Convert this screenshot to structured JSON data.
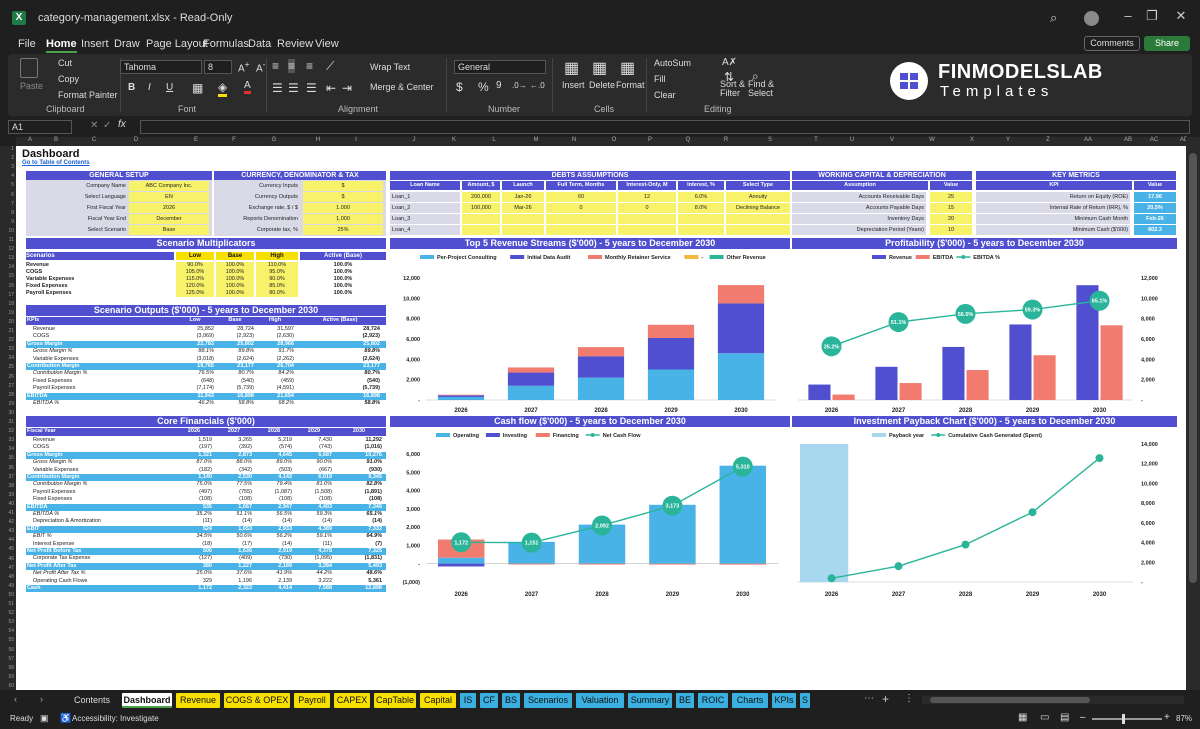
{
  "titlebar": {
    "title": "category-management.xlsx  -  Read-Only"
  },
  "menu": [
    "File",
    "Home",
    "Insert",
    "Draw",
    "Page Layout",
    "Formulas",
    "Data",
    "Review",
    "View"
  ],
  "menu_right": {
    "comments": "Comments",
    "share": "Share"
  },
  "ribbon": {
    "paste": "Paste",
    "cut": "Cut",
    "copy": "Copy",
    "format_painter": "Format Painter",
    "font_name": "Tahoma",
    "font_size": "8",
    "wrap_text": "Wrap Text",
    "merge_center": "Merge & Center",
    "number_format": "General",
    "insert": "Insert",
    "delete": "Delete",
    "format": "Format",
    "autosum": "AutoSum",
    "fill": "Fill",
    "clear": "Clear",
    "sort_filter": "Sort & Filter",
    "find_select": "Find & Select",
    "groups": [
      "Clipboard",
      "Font",
      "Alignment",
      "Number",
      "Cells",
      "Editing"
    ]
  },
  "brand": {
    "name": "FINMODELSLAB",
    "tagline": "Templates"
  },
  "formula": {
    "cell": "A1"
  },
  "columns": [
    "A",
    "B",
    "C",
    "D",
    "E",
    "F",
    "G",
    "H",
    "I",
    "J",
    "K",
    "L",
    "M",
    "N",
    "O",
    "P",
    "Q",
    "R",
    "S",
    "T",
    "U",
    "V",
    "W",
    "X",
    "Y",
    "Z",
    "AA",
    "AB",
    "AC",
    "AD"
  ],
  "sheet": {
    "title": "Dashboard",
    "toc_link": "Go to Table of Contents"
  },
  "general_setup": {
    "title": "GENERAL SETUP",
    "rows": [
      {
        "label": "Company Name",
        "value": "ABC Company Inc."
      },
      {
        "label": "Select Language",
        "value": "EN"
      },
      {
        "label": "First Fiscal Year",
        "value": "2026"
      },
      {
        "label": "Fiscal Year End",
        "value": "December"
      },
      {
        "label": "Select Scenario",
        "value": "Base"
      }
    ]
  },
  "currency": {
    "title": "CURRENCY, DENOMINATOR & TAX",
    "rows": [
      {
        "label": "Currency Inputs",
        "value": "$"
      },
      {
        "label": "Currency Outputs",
        "value": "$"
      },
      {
        "label": "Exchange rate, $ / $",
        "value": "1.000"
      },
      {
        "label": "Reports Denomination",
        "value": "1,000"
      },
      {
        "label": "Corporate tax, %",
        "value": "25%"
      }
    ]
  },
  "debts": {
    "title": "DEBTS ASSUMPTIONS",
    "headers": [
      "Loan Name",
      "Amount, $",
      "Launch",
      "Full Term, Months",
      "Interest-Only, M",
      "Interest, %",
      "Select Type"
    ],
    "rows": [
      [
        "Loan_1",
        "200,000",
        "Jan-26",
        "60",
        "12",
        "6.0%",
        "Annuity"
      ],
      [
        "Loan_2",
        "100,000",
        "Mar-26",
        "0",
        "0",
        "8.0%",
        "Declining Balance"
      ],
      [
        "Loan_3",
        "",
        "",
        "",
        "",
        "",
        ""
      ],
      [
        "Loan_4",
        "",
        "",
        "",
        "",
        "",
        ""
      ]
    ]
  },
  "working_capital": {
    "title": "WORKING CAPITAL & DEPRECIATION",
    "headers": [
      "Assumption",
      "Value"
    ],
    "rows": [
      [
        "Accounts Receivable Days",
        "25"
      ],
      [
        "Accounts Payable Days",
        "15"
      ],
      [
        "Inventory Days",
        "20"
      ],
      [
        "Depreciation Period (Years)",
        "10"
      ]
    ]
  },
  "key_metrics": {
    "title": "KEY METRICS",
    "headers": [
      "KPI",
      "Value"
    ],
    "rows": [
      [
        "Return on Equity (ROE)",
        "17.96"
      ],
      [
        "Internal Rate of Return (IRR), %",
        "20.5%"
      ],
      [
        "Minimum Cash Month",
        "Feb-26"
      ],
      [
        "Minimum Cash ($'000)",
        "802.3"
      ]
    ]
  },
  "multiplicators": {
    "title": "Scenario Multiplicators",
    "headers": [
      "Scenarios",
      "Low",
      "Base",
      "High",
      "Active (Base)"
    ],
    "rows": [
      [
        "Revenue",
        "90.0%",
        "100.0%",
        "110.0%",
        "100.0%"
      ],
      [
        "COGS",
        "105.0%",
        "100.0%",
        "95.0%",
        "100.0%"
      ],
      [
        "Variable Expenses",
        "115.0%",
        "100.0%",
        "90.0%",
        "100.0%"
      ],
      [
        "Fixed Expenses",
        "120.0%",
        "100.0%",
        "85.0%",
        "100.0%"
      ],
      [
        "Payroll Expenses",
        "125.0%",
        "100.0%",
        "80.0%",
        "100.0%"
      ]
    ]
  },
  "scenario_outputs": {
    "title": "Scenario Outputs ($'000) - 5 years to December 2030",
    "headers": [
      "KPIs",
      "Low",
      "Base",
      "High",
      "Active (Base)"
    ],
    "rows": [
      {
        "cells": [
          "Revenue",
          "25,852",
          "28,724",
          "31,597",
          "28,724"
        ],
        "style": ""
      },
      {
        "cells": [
          "COGS",
          "(3,069)",
          "(2,923)",
          "(2,630)",
          "(2,923)"
        ],
        "style": ""
      },
      {
        "cells": [
          "Gross Margin",
          "22,783",
          "25,802",
          "28,966",
          "25,802"
        ],
        "style": "hl"
      },
      {
        "cells": [
          "Gross Margin %",
          "88.1%",
          "89.8%",
          "91.7%",
          "89.8%"
        ],
        "style": "it"
      },
      {
        "cells": [
          "Variable Expenses",
          "(3,018)",
          "(2,624)",
          "(2,262)",
          "(2,624)"
        ],
        "style": ""
      },
      {
        "cells": [
          "Contribution Margin",
          "19,765",
          "23,177",
          "26,704",
          "23,177"
        ],
        "style": "hl"
      },
      {
        "cells": [
          "Contribution Margin %",
          "76.5%",
          "80.7%",
          "84.2%",
          "80.7%"
        ],
        "style": "it"
      },
      {
        "cells": [
          "Fixed Expenses",
          "(648)",
          "(540)",
          "(459)",
          "(540)"
        ],
        "style": ""
      },
      {
        "cells": [
          "Payroll Expenses",
          "(7,174)",
          "(5,739)",
          "(4,591)",
          "(5,739)"
        ],
        "style": ""
      },
      {
        "cells": [
          "EBITDA",
          "11,943",
          "16,898",
          "21,654",
          "16,898"
        ],
        "style": "hl"
      },
      {
        "cells": [
          "EBITDA %",
          "46.2%",
          "58.8%",
          "68.2%",
          "58.8%"
        ],
        "style": "it"
      }
    ]
  },
  "core_financials": {
    "title": "Core Financials ($'000)",
    "headers": [
      "Fiscal Year",
      "2026",
      "2027",
      "2028",
      "2029",
      "2030"
    ],
    "rows": [
      {
        "cells": [
          "Revenue",
          "1,519",
          "3,265",
          "5,219",
          "7,430",
          "11,292"
        ],
        "style": ""
      },
      {
        "cells": [
          "COGS",
          "(197)",
          "(392)",
          "(574)",
          "(743)",
          "(1,016)"
        ],
        "style": ""
      },
      {
        "cells": [
          "Gross Margin",
          "1,321",
          "2,873",
          "4,645",
          "6,687",
          "10,276"
        ],
        "style": "hl"
      },
      {
        "cells": [
          "Gross Margin %",
          "87.0%",
          "88.0%",
          "89.0%",
          "90.0%",
          "91.0%"
        ],
        "style": "it"
      },
      {
        "cells": [
          "Variable Expenses",
          "(182)",
          "(342)",
          "(503)",
          "(667)",
          "(930)"
        ],
        "style": ""
      },
      {
        "cells": [
          "Contribution Margin",
          "1,140",
          "2,530",
          "4,142",
          "6,019",
          "9,345"
        ],
        "style": "hl"
      },
      {
        "cells": [
          "Contribution Margin %",
          "75.0%",
          "77.5%",
          "79.4%",
          "81.0%",
          "82.8%"
        ],
        "style": "it"
      },
      {
        "cells": [
          "Payroll Expenses",
          "(497)",
          "(755)",
          "(1,087)",
          "(1,508)",
          "(1,891)"
        ],
        "style": ""
      },
      {
        "cells": [
          "Fixed Expenses",
          "(108)",
          "(108)",
          "(108)",
          "(108)",
          "(108)"
        ],
        "style": ""
      },
      {
        "cells": [
          "EBITDA",
          "535",
          "1,667",
          "2,947",
          "4,403",
          "7,346"
        ],
        "style": "hl"
      },
      {
        "cells": [
          "EBITDA %",
          "35.2%",
          "51.1%",
          "56.5%",
          "59.3%",
          "65.1%"
        ],
        "style": "it"
      },
      {
        "cells": [
          "Depreciation & Amortization",
          "(11)",
          "(14)",
          "(14)",
          "(14)",
          "(14)"
        ],
        "style": ""
      },
      {
        "cells": [
          "EBIT",
          "524",
          "1,653",
          "2,933",
          "4,389",
          "7,332"
        ],
        "style": "hl"
      },
      {
        "cells": [
          "EBIT %",
          "34.5%",
          "50.6%",
          "56.2%",
          "59.1%",
          "64.9%"
        ],
        "style": "it"
      },
      {
        "cells": [
          "Interest Expense",
          "(18)",
          "(17)",
          "(14)",
          "(11)",
          "(7)"
        ],
        "style": ""
      },
      {
        "cells": [
          "Net Profit Before Tax",
          "506",
          "1,636",
          "2,919",
          "4,378",
          "7,325"
        ],
        "style": "hl"
      },
      {
        "cells": [
          "Corporate Tax Expense",
          "(127)",
          "(409)",
          "(730)",
          "(1,095)",
          "(1,831)"
        ],
        "style": ""
      },
      {
        "cells": [
          "Net Profit After Tax",
          "380",
          "1,227",
          "2,189",
          "3,284",
          "5,493"
        ],
        "style": "hl"
      },
      {
        "cells": [
          "Net Profit After Tax %",
          "25.0%",
          "37.6%",
          "41.9%",
          "44.2%",
          "48.6%"
        ],
        "style": "it"
      },
      {
        "cells": [
          "Operating Cash Flows",
          "329",
          "1,196",
          "2,139",
          "3,222",
          "5,361"
        ],
        "style": ""
      },
      {
        "cells": [
          "Cash",
          "1,172",
          "2,323",
          "4,414",
          "7,588",
          "12,898"
        ],
        "style": "hl"
      }
    ]
  },
  "chart_data": [
    {
      "type": "bar",
      "title": "Top 5 Revenue Streams ($'000) - 5 years to December 2030",
      "categories": [
        "2026",
        "2027",
        "2028",
        "2029",
        "2030"
      ],
      "ylim": [
        0,
        12000
      ],
      "yticks": [
        "-",
        "2,000",
        "4,000",
        "6,000",
        "8,000",
        "10,000",
        "12,000"
      ],
      "series": [
        {
          "name": "Per-Project Consulting",
          "color": "#49b3e8",
          "values": [
            300,
            1400,
            2200,
            3000,
            4600
          ]
        },
        {
          "name": "Initial Data Audit",
          "color": "#4f4fd0",
          "values": [
            160,
            1300,
            2100,
            3100,
            4900
          ]
        },
        {
          "name": "Monthly Retainer Service",
          "color": "#f07b6e",
          "values": [
            60,
            500,
            900,
            1300,
            1800
          ]
        },
        {
          "name": "-",
          "color": "#f6b73c",
          "values": [
            0,
            0,
            0,
            0,
            0
          ]
        },
        {
          "name": "Other Revenue",
          "color": "#2ab59a",
          "values": [
            0,
            0,
            0,
            0,
            0
          ]
        }
      ]
    },
    {
      "type": "bar",
      "title": "Profitability ($'000) - 5 years to December 2030",
      "categories": [
        "2026",
        "2027",
        "2028",
        "2029",
        "2030"
      ],
      "ylim": [
        0,
        12000
      ],
      "yticks": [
        "-",
        "2,000",
        "4,000",
        "6,000",
        "8,000",
        "10,000",
        "12,000"
      ],
      "series": [
        {
          "name": "Revenue",
          "color": "#4f4fd0",
          "values": [
            1519,
            3265,
            5219,
            7430,
            11292
          ]
        },
        {
          "name": "EBITDA",
          "color": "#f07b6e",
          "values": [
            535,
            1667,
            2947,
            4403,
            7346
          ]
        }
      ],
      "line": {
        "name": "EBITDA %",
        "color": "#2ab59a",
        "values": [
          35.2,
          51.1,
          56.5,
          59.3,
          65.1
        ],
        "labels": [
          "35.2%",
          "51.1%",
          "56.5%",
          "59.3%",
          "65.1%"
        ],
        "ylim": [
          0,
          80
        ]
      }
    },
    {
      "type": "bar",
      "title": "Cash flow ($'000) - 5 years to December 2030",
      "categories": [
        "2026",
        "2027",
        "2028",
        "2029",
        "2030"
      ],
      "ylim": [
        -1000,
        6000
      ],
      "yticks": [
        "(1,000)",
        "-",
        "1,000",
        "2,000",
        "3,000",
        "4,000",
        "5,000",
        "6,000"
      ],
      "series": [
        {
          "name": "Operating",
          "color": "#49b3e8",
          "values": [
            329,
            1196,
            2139,
            3222,
            5361
          ]
        },
        {
          "name": "Investing",
          "color": "#4f4fd0",
          "values": [
            -150,
            0,
            0,
            0,
            0
          ]
        },
        {
          "name": "Financing",
          "color": "#f07b6e",
          "values": [
            993,
            -45,
            -48,
            -48,
            -51
          ]
        }
      ],
      "line": {
        "name": "Net Cash Flow",
        "color": "#2ab59a",
        "values": [
          1172,
          1151,
          2092,
          3173,
          5310
        ],
        "labels": [
          "1,172",
          "1,151",
          "2,092",
          "3,173",
          "5,310"
        ]
      }
    },
    {
      "type": "bar",
      "title": "Investment Payback Chart ($'000) - 5 years to December 2030",
      "categories": [
        "2026",
        "2027",
        "2028",
        "2029",
        "2030"
      ],
      "ylim": [
        0,
        14000
      ],
      "yticks": [
        "-",
        "2,000",
        "4,000",
        "6,000",
        "8,000",
        "10,000",
        "12,000",
        "14,000"
      ],
      "series": [
        {
          "name": "Payback year",
          "color": "#a8d8f0",
          "values": [
            14000,
            0,
            0,
            0,
            0
          ]
        }
      ],
      "line": {
        "name": "Cumulative Cash Generated (Spent)",
        "color": "#2ab59a",
        "values": [
          380,
          1607,
          3796,
          7080,
          12573
        ]
      }
    }
  ],
  "tabs": [
    {
      "label": "Contents",
      "color": "#1f1f1f",
      "text": "#ddd"
    },
    {
      "label": "Dashboard",
      "color": "#ffffff",
      "text": "#111"
    },
    {
      "label": "Revenue",
      "color": "#f7e000",
      "text": "#111"
    },
    {
      "label": "COGS & OPEX",
      "color": "#f7e000",
      "text": "#111"
    },
    {
      "label": "Payroll",
      "color": "#f7e000",
      "text": "#111"
    },
    {
      "label": "CAPEX",
      "color": "#f7e000",
      "text": "#111"
    },
    {
      "label": "CapTable",
      "color": "#f7e000",
      "text": "#111"
    },
    {
      "label": "Capital",
      "color": "#f7e000",
      "text": "#111"
    },
    {
      "label": "IS",
      "color": "#3ab0e0",
      "text": "#111"
    },
    {
      "label": "CF",
      "color": "#3ab0e0",
      "text": "#111"
    },
    {
      "label": "BS",
      "color": "#3ab0e0",
      "text": "#111"
    },
    {
      "label": "Scenarios",
      "color": "#3ab0e0",
      "text": "#111"
    },
    {
      "label": "Valuation",
      "color": "#3ab0e0",
      "text": "#111"
    },
    {
      "label": "Summary",
      "color": "#3ab0e0",
      "text": "#111"
    },
    {
      "label": "BE",
      "color": "#3ab0e0",
      "text": "#111"
    },
    {
      "label": "ROIC",
      "color": "#3ab0e0",
      "text": "#111"
    },
    {
      "label": "Charts",
      "color": "#3ab0e0",
      "text": "#111"
    },
    {
      "label": "KPIs",
      "color": "#3ab0e0",
      "text": "#111"
    },
    {
      "label": "S",
      "color": "#3ab0e0",
      "text": "#111"
    }
  ],
  "status": {
    "ready": "Ready",
    "accessibility": "Accessibility: Investigate",
    "zoom": "87%"
  }
}
